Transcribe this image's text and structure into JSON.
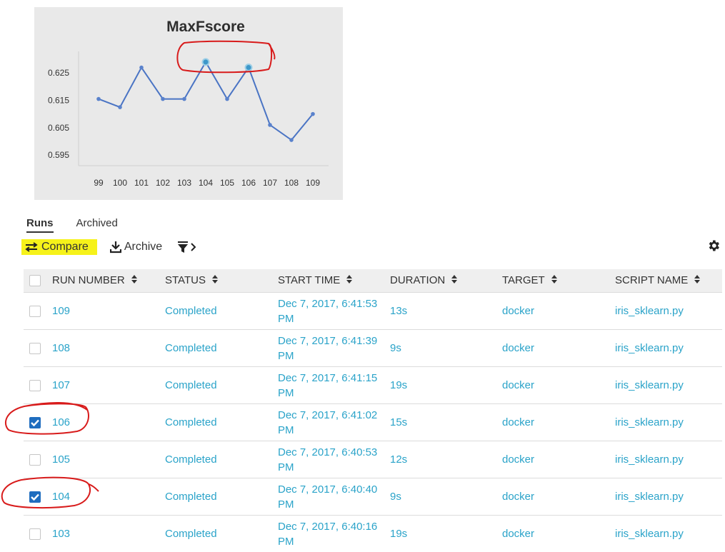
{
  "chart_data": {
    "type": "line",
    "title": "MaxFscore",
    "xlabel": "",
    "ylabel": "",
    "categories": [
      "99",
      "100",
      "101",
      "102",
      "103",
      "104",
      "105",
      "106",
      "107",
      "108",
      "109"
    ],
    "series": [
      {
        "values": [
          0.6155,
          0.6125,
          0.627,
          0.6155,
          0.6155,
          0.629,
          0.6155,
          0.627,
          0.606,
          0.6005,
          0.61
        ]
      }
    ],
    "y_ticks": [
      "0.595",
      "0.605",
      "0.615",
      "0.625"
    ],
    "ylim": [
      0.5885,
      0.6355
    ],
    "highlighted_points": [
      "104",
      "106"
    ],
    "line_color": "#4a74c4",
    "grid": false
  },
  "tabs": [
    {
      "label": "Runs",
      "active": true
    },
    {
      "label": "Archived",
      "active": false
    }
  ],
  "toolbar": {
    "compare_label": "Compare",
    "archive_label": "Archive",
    "highlight_color": "#f6f21a"
  },
  "table": {
    "columns": [
      "RUN NUMBER",
      "STATUS",
      "START TIME",
      "DURATION",
      "TARGET",
      "SCRIPT NAME"
    ],
    "rows": [
      {
        "run": "109",
        "status": "Completed",
        "time1": "Dec 7, 2017, 6:41:53",
        "time2": "PM",
        "duration": "13s",
        "target": "docker",
        "script": "iris_sklearn.py",
        "checked": false
      },
      {
        "run": "108",
        "status": "Completed",
        "time1": "Dec 7, 2017, 6:41:39",
        "time2": "PM",
        "duration": "9s",
        "target": "docker",
        "script": "iris_sklearn.py",
        "checked": false
      },
      {
        "run": "107",
        "status": "Completed",
        "time1": "Dec 7, 2017, 6:41:15",
        "time2": "PM",
        "duration": "19s",
        "target": "docker",
        "script": "iris_sklearn.py",
        "checked": false
      },
      {
        "run": "106",
        "status": "Completed",
        "time1": "Dec 7, 2017, 6:41:02",
        "time2": "PM",
        "duration": "15s",
        "target": "docker",
        "script": "iris_sklearn.py",
        "checked": true
      },
      {
        "run": "105",
        "status": "Completed",
        "time1": "Dec 7, 2017, 6:40:53",
        "time2": "PM",
        "duration": "12s",
        "target": "docker",
        "script": "iris_sklearn.py",
        "checked": false
      },
      {
        "run": "104",
        "status": "Completed",
        "time1": "Dec 7, 2017, 6:40:40",
        "time2": "PM",
        "duration": "9s",
        "target": "docker",
        "script": "iris_sklearn.py",
        "checked": true
      },
      {
        "run": "103",
        "status": "Completed",
        "time1": "Dec 7, 2017, 6:40:16",
        "time2": "PM",
        "duration": "19s",
        "target": "docker",
        "script": "iris_sklearn.py",
        "checked": false
      }
    ]
  },
  "colors": {
    "link": "#2aa3c9",
    "checkbox_checked": "#1f6dbf",
    "annotation": "#d81b1b"
  }
}
